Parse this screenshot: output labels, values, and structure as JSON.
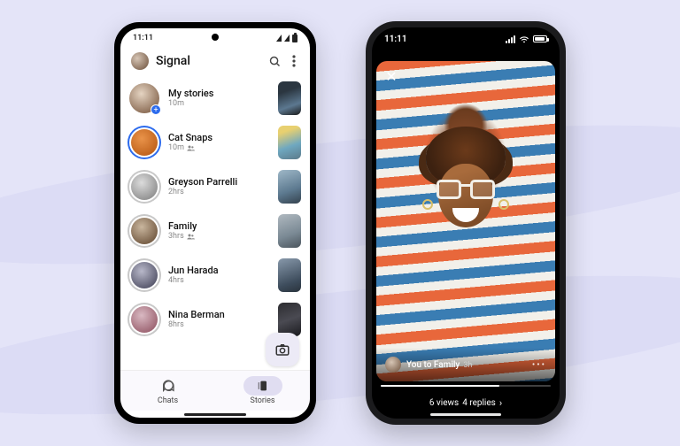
{
  "android": {
    "status": {
      "time": "11:11"
    },
    "header": {
      "title": "Signal"
    },
    "stories": [
      {
        "name": "My stories",
        "meta": "10m",
        "is_group": false,
        "has_add": true,
        "ring": "none"
      },
      {
        "name": "Cat Snaps",
        "meta": "10m",
        "is_group": true,
        "has_add": false,
        "ring": "blue"
      },
      {
        "name": "Greyson Parrelli",
        "meta": "2hrs",
        "is_group": false,
        "has_add": false,
        "ring": "grey"
      },
      {
        "name": "Family",
        "meta": "3hrs",
        "is_group": true,
        "has_add": false,
        "ring": "grey"
      },
      {
        "name": "Jun Harada",
        "meta": "4hrs",
        "is_group": false,
        "has_add": false,
        "ring": "grey"
      },
      {
        "name": "Nina Berman",
        "meta": "8hrs",
        "is_group": false,
        "has_add": false,
        "ring": "grey"
      }
    ],
    "tabs": {
      "chats": "Chats",
      "stories": "Stories",
      "active": "stories"
    }
  },
  "ios": {
    "status": {
      "time": "11:11"
    },
    "story": {
      "author_line": "You to Family",
      "time": "3h",
      "views_label": "6 views",
      "replies_label": "4 replies"
    }
  },
  "colors": {
    "bg": "#e4e4f8",
    "wave": "#dcdcf5",
    "ring_blue": "#2c6bed",
    "tab_active_pill": "#e0ddf1"
  }
}
